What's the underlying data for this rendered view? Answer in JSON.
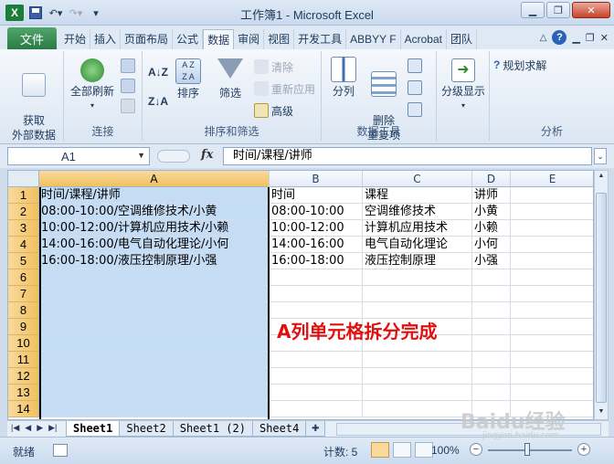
{
  "window": {
    "title": "工作簿1 - Microsoft Excel",
    "app_logo": "X",
    "buttons": [
      "minimize",
      "restore",
      "close"
    ]
  },
  "ribbon_tabs": {
    "file": "文件",
    "tabs": [
      "开始",
      "插入",
      "页面布局",
      "公式",
      "数据",
      "审阅",
      "视图",
      "开发工具",
      "ABBYY F",
      "Acrobat",
      "团队"
    ],
    "active_index": 4
  },
  "ribbon": {
    "connections": {
      "label": "连接",
      "get_external": "获取\n外部数据",
      "refresh_all": "全部刷新"
    },
    "sort_filter": {
      "label": "排序和筛选",
      "sort": "排序",
      "filter": "筛选",
      "clear": "清除",
      "reapply": "重新应用",
      "advanced": "高级"
    },
    "data_tools": {
      "label": "数据工具",
      "split": "分列",
      "remove_dup": "删除\n重复项"
    },
    "outline": {
      "label": "分级显示",
      "group": "分级显示"
    },
    "analysis": {
      "label": "分析",
      "solver": "规划求解"
    }
  },
  "formula_bar": {
    "name_box": "A1",
    "fx": "fx",
    "formula": "时间/课程/讲师"
  },
  "grid": {
    "columns": [
      "A",
      "B",
      "C",
      "D",
      "E"
    ],
    "rows": [
      "1",
      "2",
      "3",
      "4",
      "5",
      "6",
      "7",
      "8",
      "9",
      "10",
      "11",
      "12",
      "13",
      "14"
    ],
    "colA": [
      "时间/课程/讲师",
      "08:00-10:00/空调维修技术/小黄",
      "10:00-12:00/计算机应用技术/小赖",
      "14:00-16:00/电气自动化理论/小何",
      "16:00-18:00/液压控制原理/小强"
    ],
    "colB": [
      "时间",
      "08:00-10:00",
      "10:00-12:00",
      "14:00-16:00",
      "16:00-18:00"
    ],
    "colC": [
      "课程",
      "空调维修技术",
      "计算机应用技术",
      "电气自动化理论",
      "液压控制原理"
    ],
    "colD": [
      "讲师",
      "小黄",
      "小赖",
      "小何",
      "小强"
    ]
  },
  "annotation": "A列单元格拆分完成",
  "sheet_tabs": [
    "Sheet1",
    "Sheet2",
    "Sheet1 (2)",
    "Sheet4"
  ],
  "active_sheet": 0,
  "status": {
    "ready": "就绪",
    "count": "计数: 5",
    "zoom": "100%"
  },
  "watermark": {
    "text": "Baidu经验",
    "sub": "jingyan.baidu.com"
  },
  "colors": {
    "selection": "#c5dcf5",
    "header_selected": "#f1c15f",
    "annotation": "#e01010",
    "file_tab": "#2c7a44"
  }
}
